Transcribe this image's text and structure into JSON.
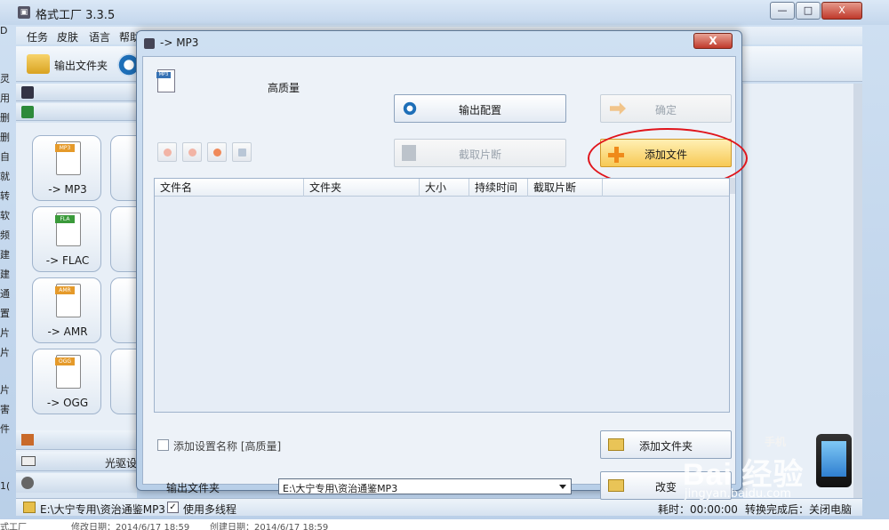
{
  "main_window": {
    "title": "格式工厂 3.3.5",
    "controls": {
      "minimize": "—",
      "maximize": "□",
      "close": "X"
    }
  },
  "menu": [
    "任务",
    "皮肤",
    "语言",
    "帮助"
  ],
  "toolbar": {
    "output_folder": "输出文件夹"
  },
  "left_edge_chars": [
    "D",
    "灵",
    "用",
    "删",
    "删",
    "自",
    "就",
    "转",
    "软",
    "频",
    "建",
    "建",
    "通",
    "置",
    "片",
    "片",
    "片",
    "害",
    "件",
    "1("
  ],
  "format_tiles": [
    {
      "tag": "MP3",
      "label": "-> MP3"
    },
    {
      "tag": "FLA",
      "label": "-> FLAC"
    },
    {
      "tag": "AMR",
      "label": "-> AMR"
    },
    {
      "tag": "OGG",
      "label": "-> OGG"
    }
  ],
  "bottom_category": {
    "label": "光驱设"
  },
  "statusbar": {
    "path": "E:\\大宁专用\\资治通鉴MP3",
    "checkbox_mark": "✓",
    "multithread": "使用多线程",
    "elapsed": "耗时：00:00:00",
    "after_done": "转换完成后：关闭电脑"
  },
  "bottom_strip": {
    "app": "式工厂",
    "modified": "修改日期：2014/6/17 18:59",
    "created": "创建日期：2014/6/17 18:59"
  },
  "dialog": {
    "title": "-> MP3",
    "close": "X",
    "icon_tag": "MP3",
    "quality": "高质量",
    "output_config": "输出配置",
    "clip": "截取片断",
    "ok": "确定",
    "add_file": "添加文件",
    "columns": [
      "文件名",
      "文件夹",
      "大小",
      "持续时间",
      "截取片断"
    ],
    "add_name_label": "添加设置名称 [高质量]",
    "add_folder": "添加文件夹",
    "output_folder_label": "输出文件夹",
    "output_path": "E:\\大宁专用\\资治通鉴MP3",
    "change": "改变"
  },
  "watermark": {
    "brand": "Bai 经验",
    "url": "jingyan.baidu.com",
    "machine": "手机"
  },
  "colors": {
    "highlight": "#e0141b",
    "add_file_bg": "#f7c955",
    "title_blue": "#c3d6ec"
  }
}
